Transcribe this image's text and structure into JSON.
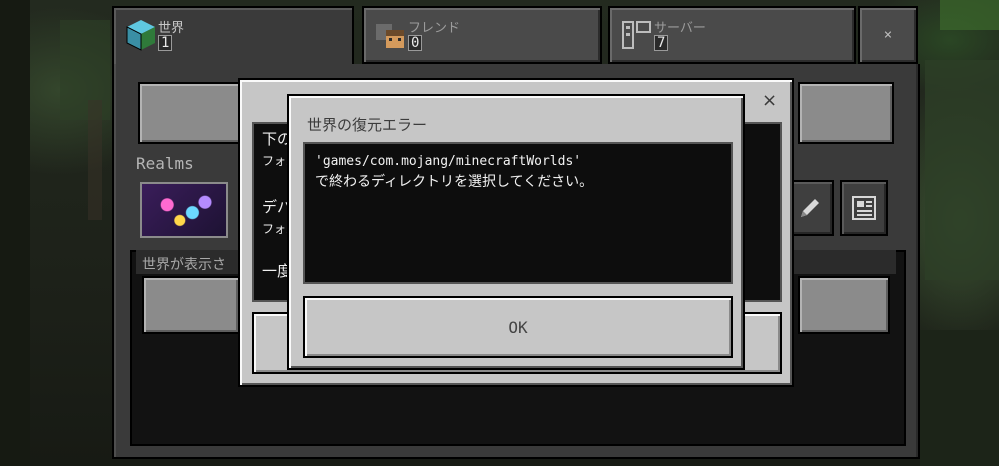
{
  "tabs": [
    {
      "label": "世界",
      "count": "1",
      "icon": "world-cube-icon"
    },
    {
      "label": "フレンド",
      "count": "0",
      "icon": "friend-face-icon"
    },
    {
      "label": "サーバー",
      "count": "7",
      "icon": "server-icon"
    }
  ],
  "close_label": "×",
  "realms_label": "Realms",
  "list_header": "世界が表示さ",
  "back_dialog": {
    "close_label": "×",
    "lines": [
      "下の",
      "フォル",
      "デバ",
      "フォル",
      "一度"
    ]
  },
  "error_dialog": {
    "title": "世界の復元エラー",
    "message_path": "'games/com.mojang/minecraftWorlds'",
    "message_text": "で終わるディレクトリを選択してください。",
    "ok_label": "OK"
  },
  "colors": {
    "dialog_bg": "#c6c6c6",
    "text_area_bg": "#0d0d0d",
    "panel_bg": "#3a3a3a"
  }
}
